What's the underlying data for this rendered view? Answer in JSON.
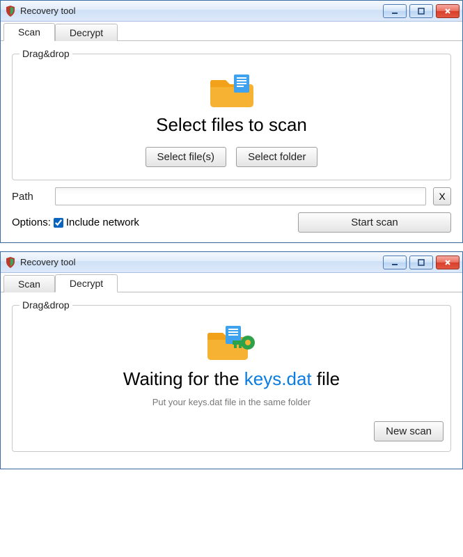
{
  "windows": [
    {
      "title": "Recovery tool",
      "tabs": {
        "scan": "Scan",
        "decrypt": "Decrypt",
        "active": "scan"
      },
      "dragdrop": {
        "legend": "Drag&drop",
        "headline": "Select files to scan",
        "select_files_btn": "Select file(s)",
        "select_folder_btn": "Select folder"
      },
      "path": {
        "label": "Path",
        "value": "",
        "clear_btn": "X"
      },
      "options": {
        "label": "Options:",
        "include_network_label": "Include network",
        "include_network_checked": true
      },
      "start_scan_btn": "Start scan"
    },
    {
      "title": "Recovery tool",
      "tabs": {
        "scan": "Scan",
        "decrypt": "Decrypt",
        "active": "decrypt"
      },
      "dragdrop": {
        "legend": "Drag&drop",
        "wait_prefix": "Waiting for the",
        "wait_file": "keys.dat",
        "wait_suffix": "file",
        "hint": "Put your keys.dat file in the same folder",
        "new_scan_btn": "New scan"
      }
    }
  ],
  "icons": {
    "app": "shield-icon",
    "minimize": "minimize-icon",
    "maximize": "maximize-icon",
    "close": "close-icon",
    "folder_doc": "folder-document-icon",
    "folder_key": "folder-key-icon"
  }
}
